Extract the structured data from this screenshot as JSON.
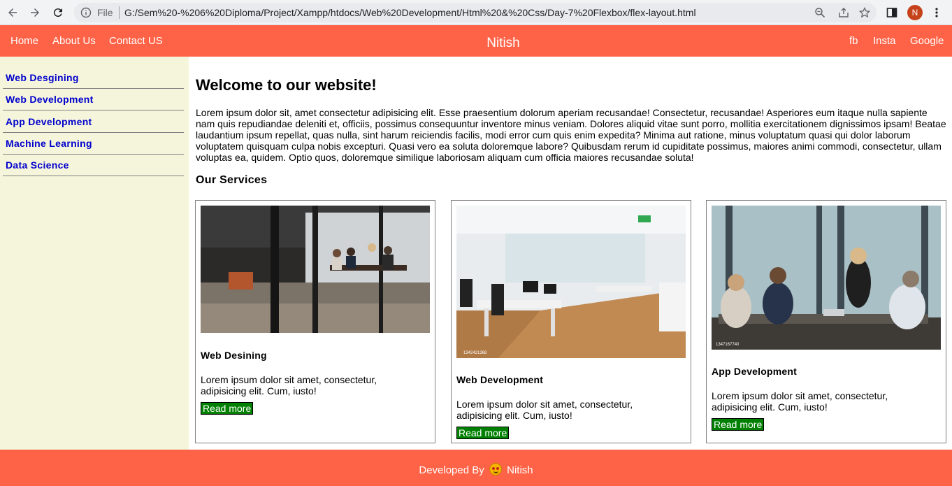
{
  "browser": {
    "file_label": "File",
    "url": "G:/Sem%20-%206%20Diploma/Project/Xampp/htdocs/Web%20Development/Html%20&%20Css/Day-7%20Flexbox/flex-layout.html",
    "profile_initial": "N",
    "icons": [
      "back-arrow-icon",
      "forward-arrow-icon",
      "reload-icon",
      "info-icon",
      "zoom-icon",
      "share-icon",
      "star-icon",
      "sidebar-icon",
      "kebab-menu-icon"
    ]
  },
  "header": {
    "nav_left": [
      "Home",
      "About Us",
      "Contact US"
    ],
    "brand": "Nitish",
    "nav_right": [
      "fb",
      "Insta",
      "Google"
    ],
    "bg_color": "#ff6347"
  },
  "sidebar": {
    "items": [
      "Web Desgining",
      "Web Development",
      "App Development",
      "Machine Learning",
      "Data Science"
    ],
    "bg_color": "#f5f5dc",
    "link_color": "#0000cd"
  },
  "main": {
    "title": "Welcome to our website!",
    "intro": "Lorem ipsum dolor sit, amet consectetur adipisicing elit. Esse praesentium dolorum aperiam recusandae! Consectetur, recusandae! Asperiores eum itaque nulla sapiente nam quis repudiandae deleniti et, officiis, possimus consequuntur inventore minus veniam. Dolores aliquid vitae sunt porro, mollitia exercitationem dignissimos ipsam! Beatae laudantium ipsum repellat, quas nulla, sint harum reiciendis facilis, modi error cum quis enim expedita? Minima aut ratione, minus voluptatum quasi qui dolor laborum voluptatem quisquam culpa nobis excepturi. Quasi vero ea soluta doloremque labore? Quibusdam rerum id cupiditate possimus, maiores animi commodi, consectetur, ullam voluptas ea, quidem. Optio quos, doloremque similique laboriosam aliquam cum officia maiores recusandae soluta!",
    "services_title": "Our Services",
    "cards": [
      {
        "title": "Web Desining",
        "desc": "Lorem ipsum dolor sit amet, consectetur, adipisicing elit. Cum, iusto!",
        "button": "Read more"
      },
      {
        "title": "Web Development",
        "desc": "Lorem ipsum dolor sit amet, consectetur, adipisicing elit. Cum, iusto!",
        "button": "Read more"
      },
      {
        "title": "App Development",
        "desc": "Lorem ipsum dolor sit amet, consectetur, adipisicing elit. Cum, iusto!",
        "button": "Read more"
      }
    ],
    "button_color": "#008000"
  },
  "footer": {
    "prefix": "Developed By",
    "name": "Nitish"
  }
}
